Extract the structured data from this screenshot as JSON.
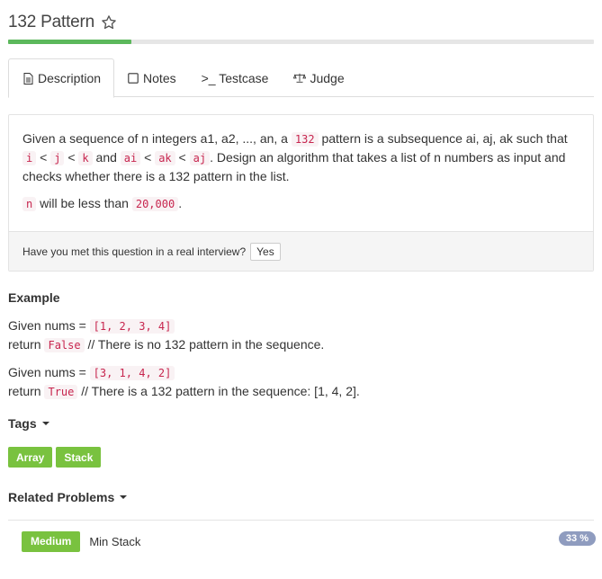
{
  "problem": {
    "title": "132 Pattern",
    "progress_fraction": 0.21
  },
  "tabs": [
    {
      "label": "Description",
      "icon": "document-icon"
    },
    {
      "label": "Notes",
      "icon": "note-icon"
    },
    {
      "label": ">_ Testcase",
      "icon": "terminal-icon"
    },
    {
      "label": "Judge",
      "icon": "scale-icon"
    }
  ],
  "description": {
    "line1_a": "Given a sequence of n integers a1, a2, ..., an, a ",
    "code_132": "132",
    "line1_b": " pattern is a subsequence ai, aj, ak such that ",
    "code_i": "i",
    "lt1": " < ",
    "code_j": "j",
    "lt2": " < ",
    "code_k": "k",
    "and1": " and ",
    "code_ai": "ai",
    "lt3": " < ",
    "code_ak": "ak",
    "lt4": " < ",
    "code_aj": "aj",
    "line1_c": ". Design an algorithm that takes a list of n numbers as input and checks whether there is a 132 pattern in the list.",
    "code_n": "n",
    "line2_a": " will be less than ",
    "code_limit": "20,000",
    "line2_b": ".",
    "interview_question": "Have you met this question in a real interview?",
    "yes_label": "Yes"
  },
  "example": {
    "heading": "Example",
    "cases": [
      {
        "given": "Given nums = ",
        "nums": "[1, 2, 3, 4]",
        "return_label": "return ",
        "result": "False",
        "comment": " // There is no 132 pattern in the sequence."
      },
      {
        "given": "Given nums = ",
        "nums": "[3, 1, 4, 2]",
        "return_label": "return ",
        "result": "True",
        "comment": " // There is a 132 pattern in the sequence: [1, 4, 2]."
      }
    ]
  },
  "tags": {
    "heading": "Tags",
    "items": [
      "Array",
      "Stack"
    ]
  },
  "related": {
    "heading": "Related Problems",
    "items": [
      {
        "difficulty": "Medium",
        "title": "Min Stack",
        "percent": "33 %"
      }
    ]
  },
  "colors": {
    "accent_green": "#79c23f",
    "progress_green": "#5cb85c",
    "code_red": "#c7254e",
    "percent_badge": "#8f9cbf"
  }
}
